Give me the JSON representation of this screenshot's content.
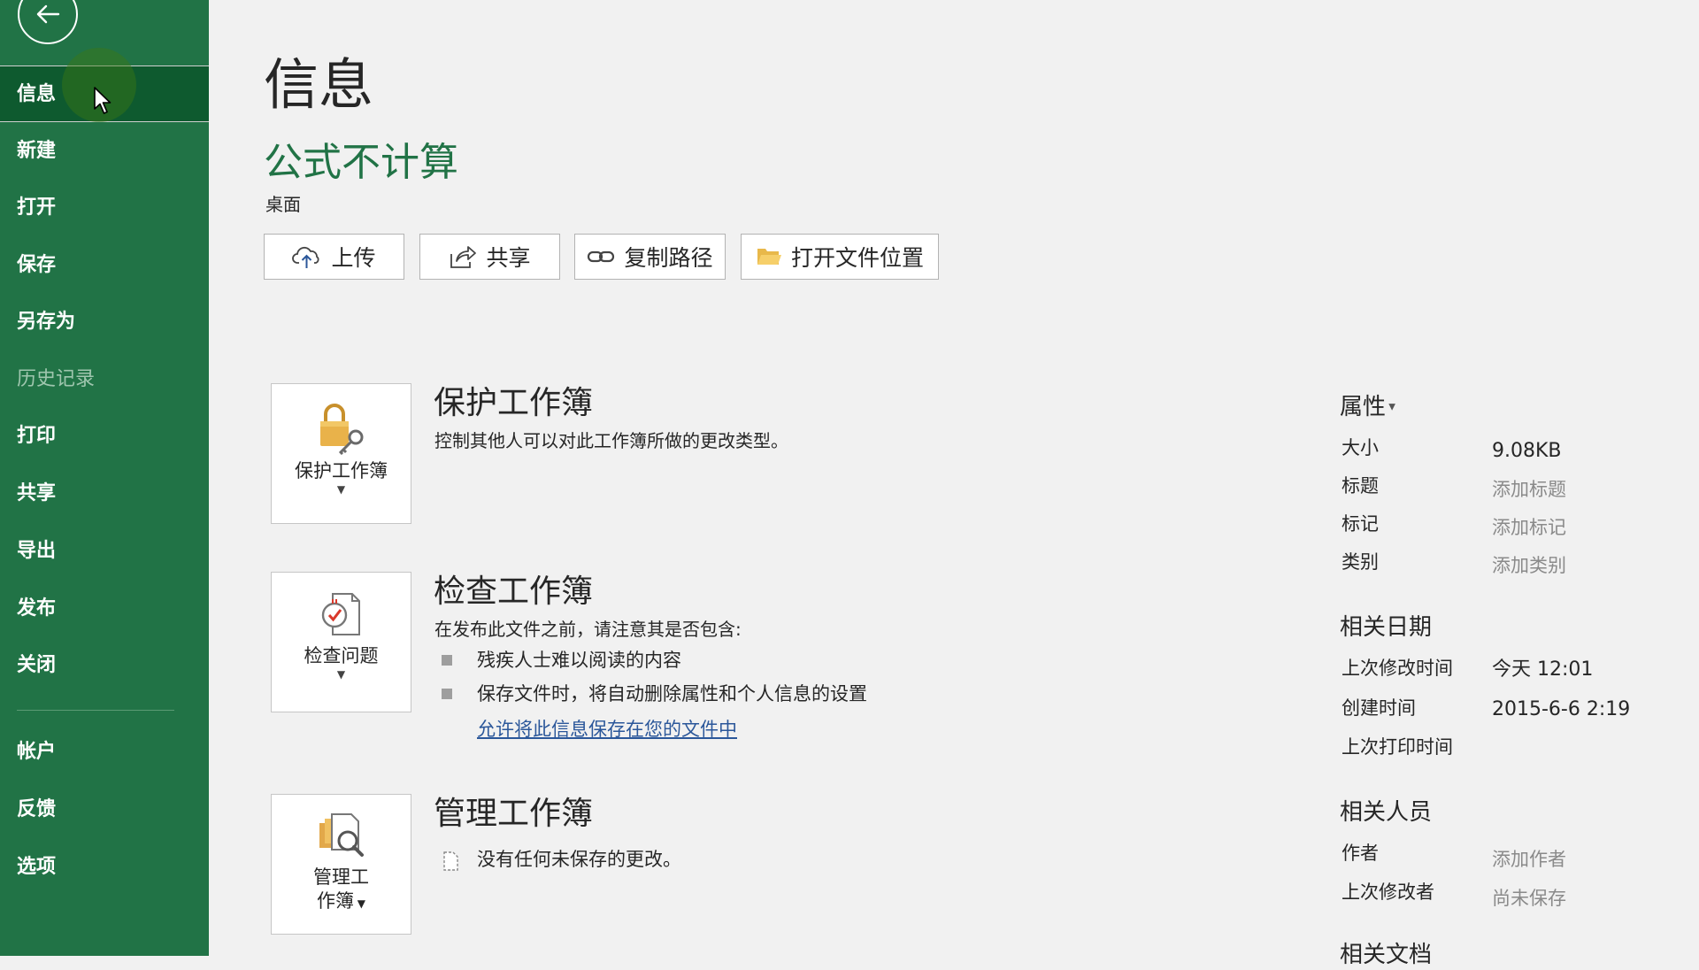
{
  "sidebar": {
    "items": [
      {
        "label": "信息",
        "active": true
      },
      {
        "label": "新建"
      },
      {
        "label": "打开"
      },
      {
        "label": "保存"
      },
      {
        "label": "另存为"
      },
      {
        "label": "历史记录",
        "disabled": true
      },
      {
        "label": "打印"
      },
      {
        "label": "共享"
      },
      {
        "label": "导出"
      },
      {
        "label": "发布"
      },
      {
        "label": "关闭"
      },
      {
        "label": "帐户"
      },
      {
        "label": "反馈"
      },
      {
        "label": "选项"
      }
    ]
  },
  "main": {
    "title": "信息",
    "doc_title": "公式不计算",
    "doc_location": "桌面",
    "actions": {
      "upload": "上传",
      "share": "共享",
      "copy_path": "复制路径",
      "open_location": "打开文件位置"
    },
    "protect": {
      "card_label": "保护工作簿",
      "title": "保护工作簿",
      "desc": "控制其他人可以对此工作簿所做的更改类型。"
    },
    "inspect": {
      "card_label": "检查问题",
      "title": "检查工作簿",
      "desc": "在发布此文件之前，请注意其是否包含:",
      "bullets": [
        "残疾人士难以阅读的内容",
        "保存文件时，将自动删除属性和个人信息的设置"
      ],
      "link": "允许将此信息保存在您的文件中"
    },
    "manage": {
      "card_label_line1": "管理工",
      "card_label_line2": "作簿",
      "title": "管理工作簿",
      "status": "没有任何未保存的更改。"
    }
  },
  "properties": {
    "heading": "属性",
    "rows": [
      {
        "label": "大小",
        "value": "9.08KB"
      },
      {
        "label": "标题",
        "value": "添加标题"
      },
      {
        "label": "标记",
        "value": "添加标记"
      },
      {
        "label": "类别",
        "value": "添加类别"
      }
    ],
    "dates_heading": "相关日期",
    "dates": [
      {
        "label": "上次修改时间",
        "value": "今天 12:01"
      },
      {
        "label": "创建时间",
        "value": "2015-6-6 2:19"
      },
      {
        "label": "上次打印时间",
        "value": ""
      }
    ],
    "people_heading": "相关人员",
    "people": [
      {
        "label": "作者",
        "value": "添加作者"
      },
      {
        "label": "上次修改者",
        "value": "尚未保存"
      }
    ],
    "docs_heading": "相关文档"
  },
  "colors": {
    "sidebar": "#217346",
    "sidebar_active": "#0e5a2f",
    "accent": "#217346",
    "link": "#2b579a",
    "background": "#f1f1f1"
  }
}
